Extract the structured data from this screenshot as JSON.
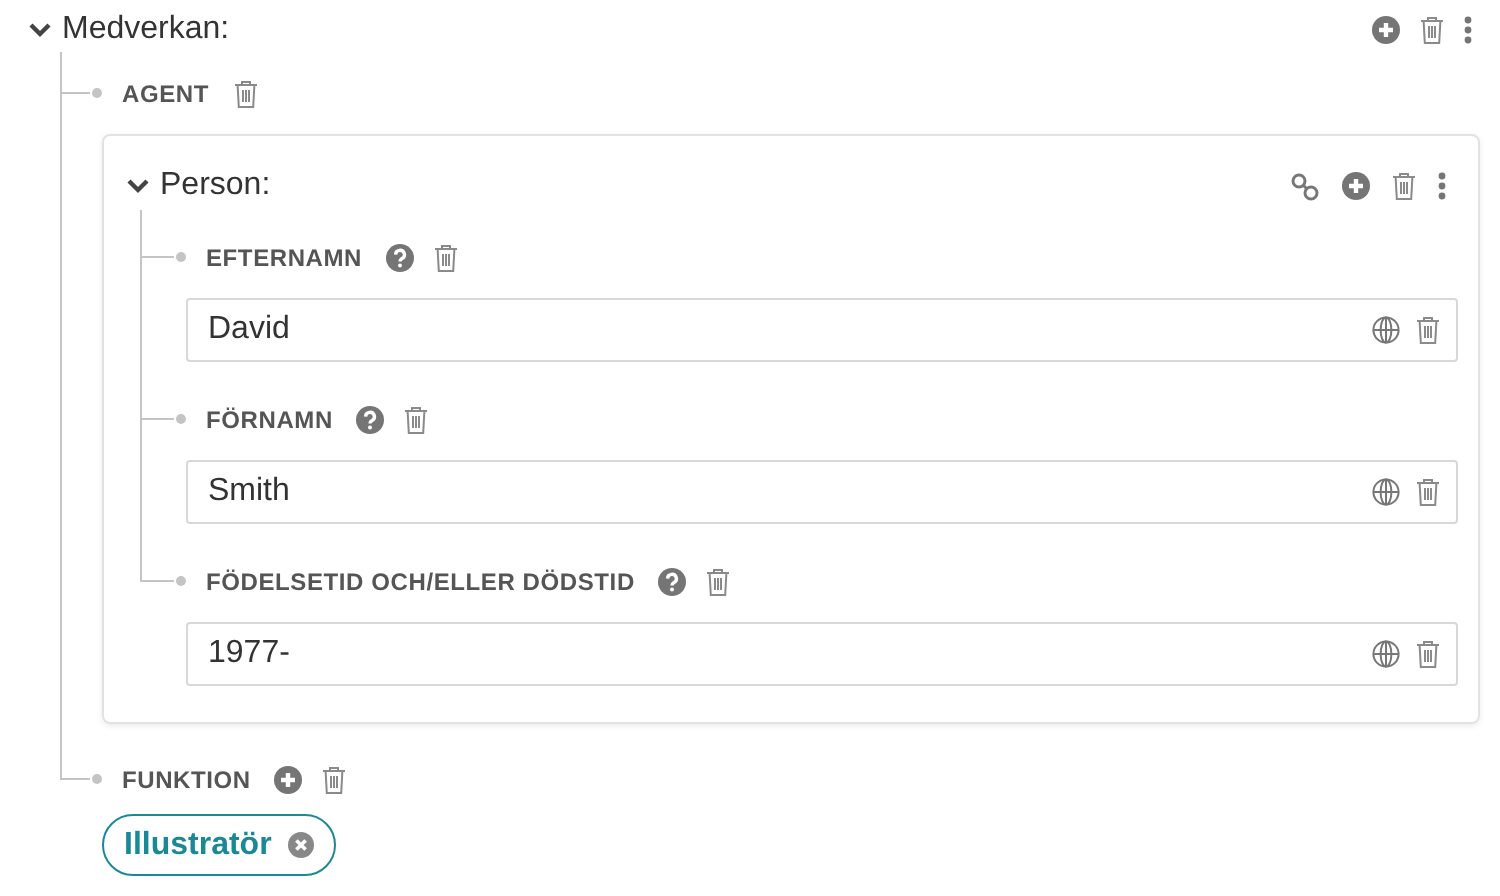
{
  "section": {
    "title": "Medverkan:",
    "expanded": true,
    "children": [
      {
        "kind": "entity",
        "label": "AGENT",
        "entity": {
          "title": "Person:",
          "expanded": true,
          "fields": [
            {
              "label": "EFTERNAMN",
              "value": "David"
            },
            {
              "label": "FÖRNAMN",
              "value": "Smith"
            },
            {
              "label": "FÖDELSETID OCH/ELLER DÖDSTID",
              "value": "1977-"
            }
          ]
        }
      },
      {
        "kind": "tags",
        "label": "FUNKTION",
        "tags": [
          "Illustratör"
        ]
      }
    ]
  }
}
